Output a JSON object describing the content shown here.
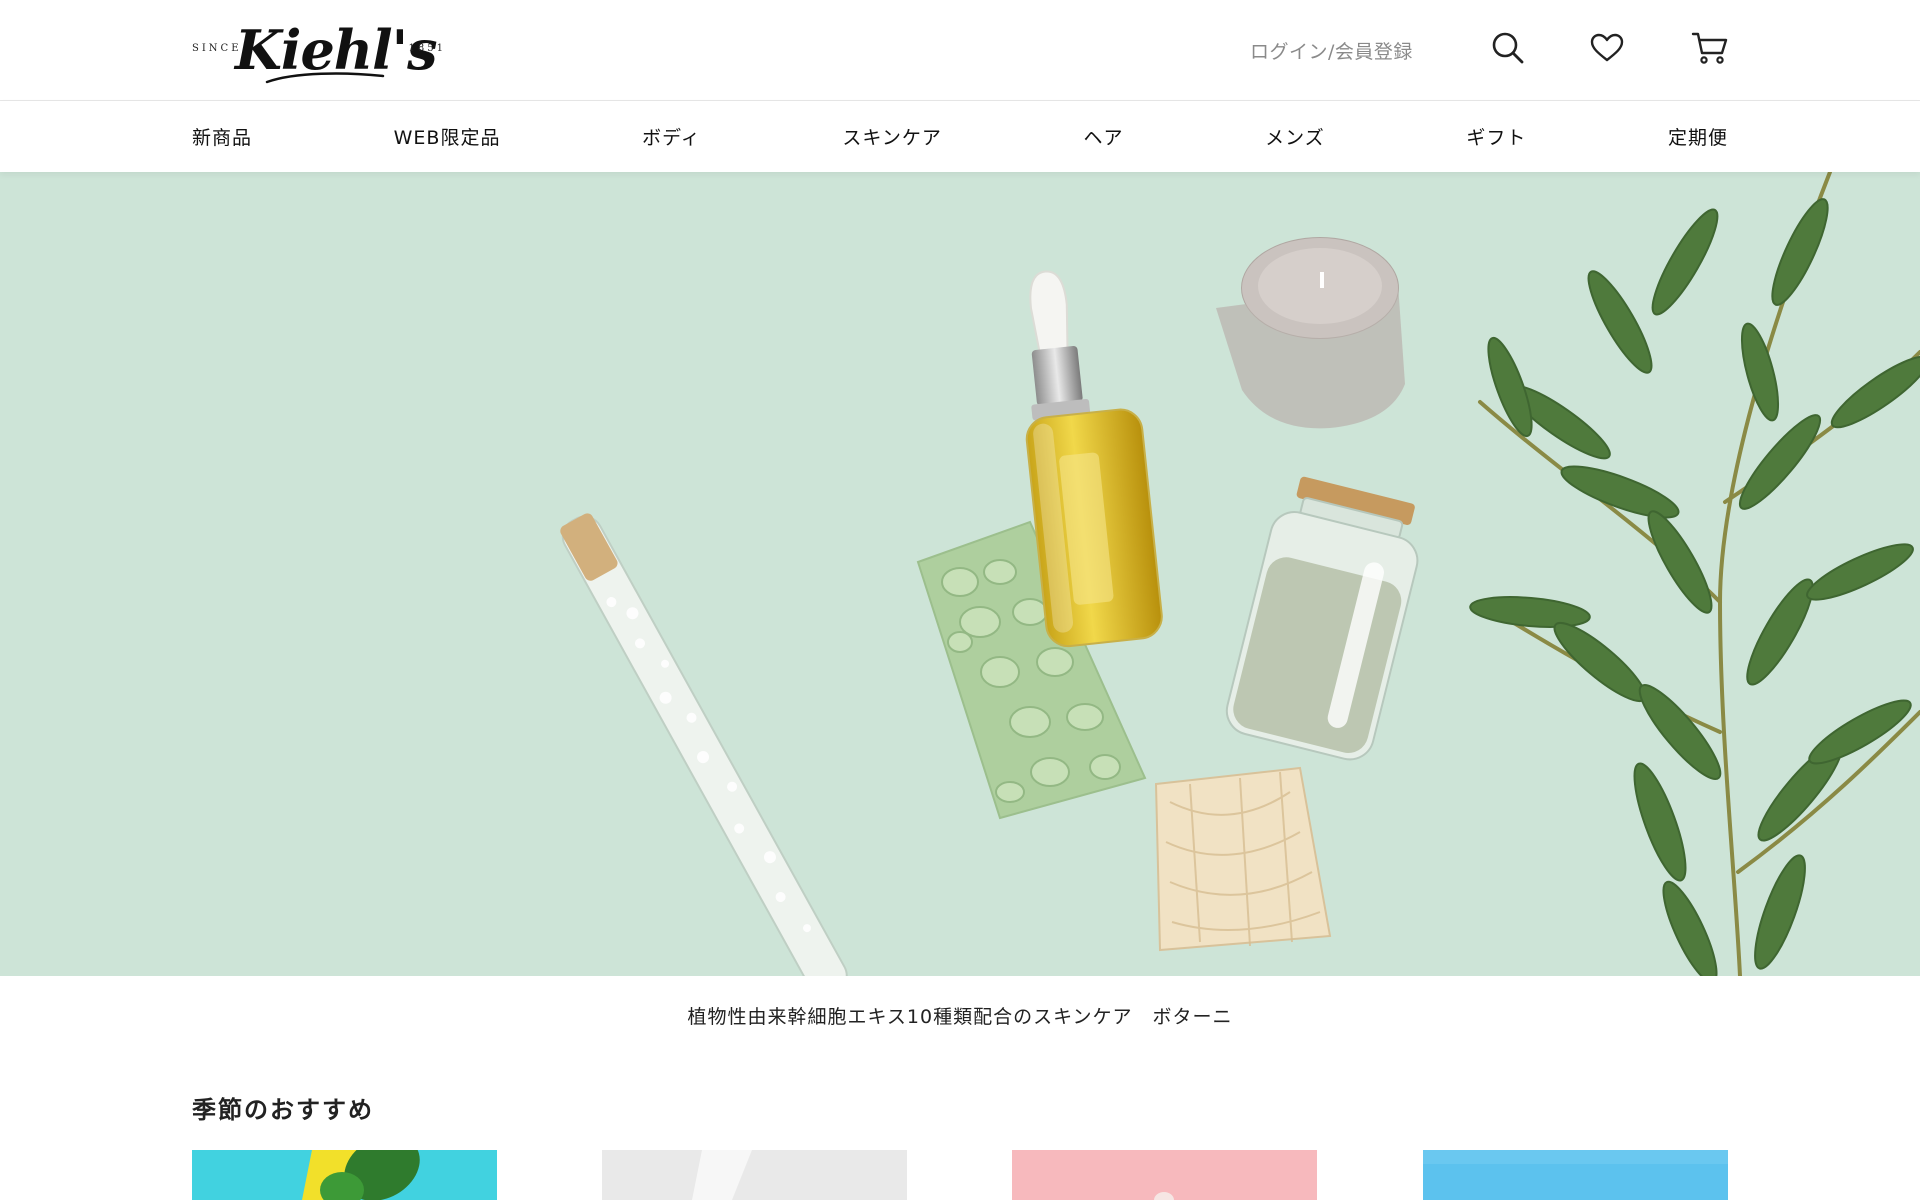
{
  "header": {
    "logo": {
      "brand": "Kiehl's",
      "since": "SINCE",
      "year": "1851"
    },
    "login_label": "ログイン/会員登録",
    "icons": [
      "search-icon",
      "heart-icon",
      "cart-icon"
    ]
  },
  "nav": {
    "items": [
      {
        "label": "新商品"
      },
      {
        "label": "WEB限定品"
      },
      {
        "label": "ボディ"
      },
      {
        "label": "スキンケア"
      },
      {
        "label": "ヘア"
      },
      {
        "label": "メンズ"
      },
      {
        "label": "ギフト"
      },
      {
        "label": "定期便"
      }
    ]
  },
  "hero": {
    "caption": "植物性由来幹細胞エキス10種類配合のスキンケア　ボターニ"
  },
  "section": {
    "title": "季節のおすすめ"
  },
  "colors": {
    "hero_bg": "#cde4d7",
    "text": "#222222",
    "muted": "#8a8a8a"
  }
}
